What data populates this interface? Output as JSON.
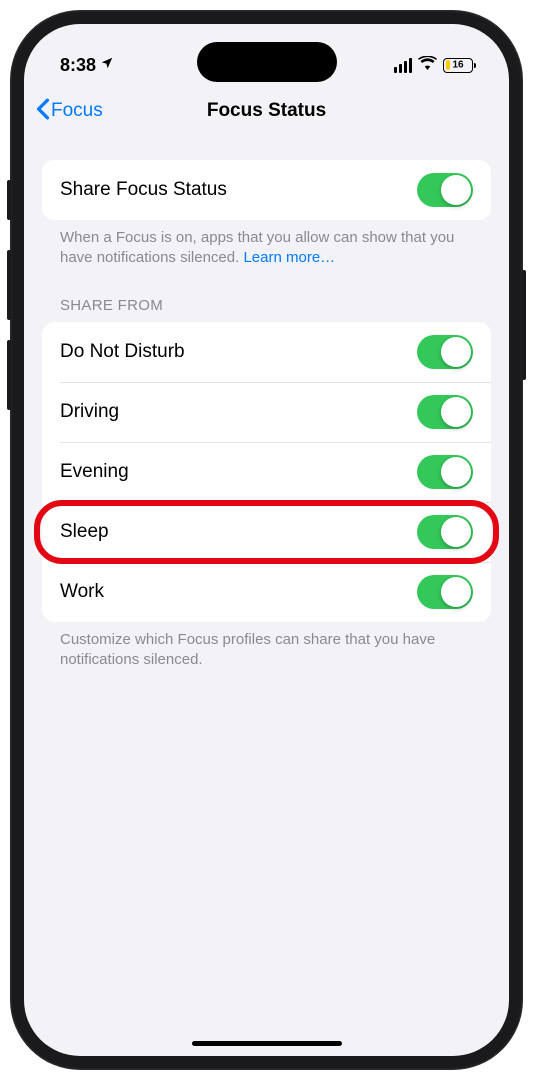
{
  "status": {
    "time": "8:38",
    "battery_percent": "16"
  },
  "nav": {
    "back_label": "Focus",
    "title": "Focus Status"
  },
  "share_toggle": {
    "label": "Share Focus Status",
    "on": true
  },
  "share_footer": "When a Focus is on, apps that you allow can show that you have notifications silenced. ",
  "share_footer_link": "Learn more…",
  "section_header": "SHARE FROM",
  "profiles": [
    {
      "label": "Do Not Disturb",
      "on": true,
      "highlight": false
    },
    {
      "label": "Driving",
      "on": true,
      "highlight": false
    },
    {
      "label": "Evening",
      "on": true,
      "highlight": false
    },
    {
      "label": "Sleep",
      "on": true,
      "highlight": true
    },
    {
      "label": "Work",
      "on": true,
      "highlight": false
    }
  ],
  "profiles_footer": "Customize which Focus profiles can share that you have notifications silenced."
}
